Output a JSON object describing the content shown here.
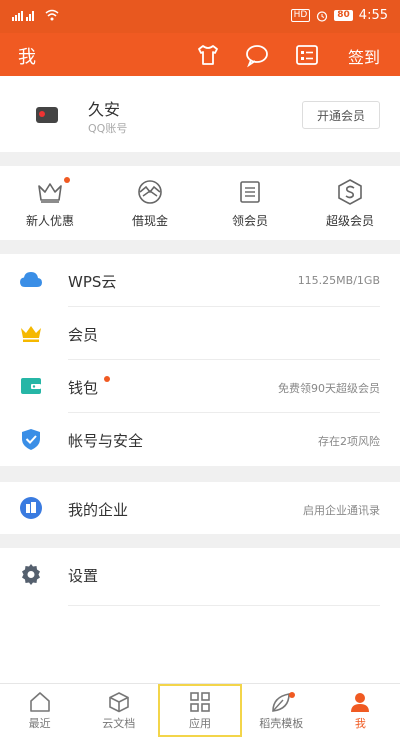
{
  "status": {
    "signal": "ᴫ.ᴫᴫ",
    "hd": "HD",
    "battery": "80",
    "time": "4:55"
  },
  "header": {
    "title": "我",
    "signin": "签到"
  },
  "profile": {
    "name": "久安",
    "subtitle": "QQ账号",
    "vip_button": "开通会员"
  },
  "quick_actions": [
    {
      "label": "新人优惠"
    },
    {
      "label": "借现金"
    },
    {
      "label": "领会员"
    },
    {
      "label": "超级会员"
    }
  ],
  "menu": {
    "wps_cloud": {
      "label": "WPS云",
      "value": "115.25MB/1GB"
    },
    "member": {
      "label": "会员"
    },
    "wallet": {
      "label": "钱包",
      "value": "免费领90天超级会员"
    },
    "account": {
      "label": "帐号与安全",
      "value": "存在2项风险"
    },
    "enterprise": {
      "label": "我的企业",
      "value": "启用企业通讯录"
    },
    "settings": {
      "label": "设置"
    }
  },
  "bottom_nav": [
    {
      "label": "最近"
    },
    {
      "label": "云文档"
    },
    {
      "label": "应用"
    },
    {
      "label": "稻壳模板"
    },
    {
      "label": "我"
    }
  ],
  "colors": {
    "accent": "#f05a22",
    "cloud": "#3a8ee6",
    "crown": "#f5b800",
    "wallet": "#26b6a6",
    "shield": "#3a8ee6",
    "enterprise": "#3a7be0"
  }
}
